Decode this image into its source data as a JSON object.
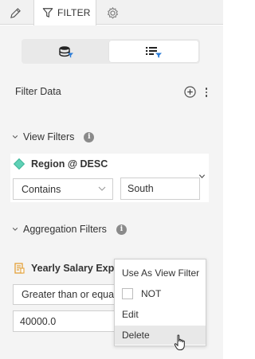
{
  "tabs": {
    "filter_label": "FILTER",
    "edit_icon": "pencil-icon",
    "filter_icon": "funnel-icon",
    "settings_icon": "gear-icon"
  },
  "toggle": {
    "left_icon": "database-filter-icon",
    "right_icon": "list-filter-icon",
    "selected": "right"
  },
  "filter_data": {
    "label": "Filter Data"
  },
  "view_filters": {
    "label": "View Filters",
    "filter": {
      "title": "Region @ DESC",
      "operator": "Contains",
      "value": "South"
    }
  },
  "aggregation_filters": {
    "label": "Aggregation Filters",
    "filter": {
      "title": "Yearly Salary Expe",
      "operator": "Greater than or equal",
      "value": "40000.0"
    }
  },
  "context_menu": {
    "items": [
      "Use As View Filter",
      "NOT",
      "Edit",
      "Delete"
    ],
    "hovered": "Delete"
  },
  "colors": {
    "accent": "#2a7bd6",
    "dimension_diamond": "#5fd1b6",
    "measure_icon": "#e4a23a"
  }
}
